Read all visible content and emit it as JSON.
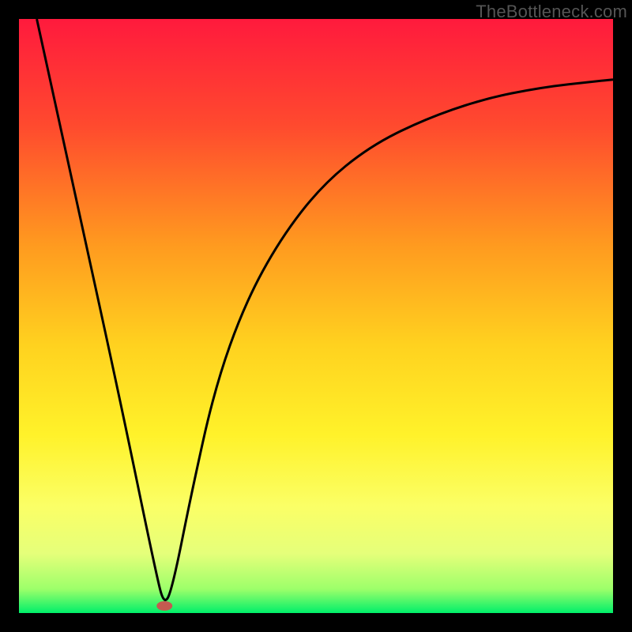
{
  "watermark": "TheBottleneck.com",
  "chart_data": {
    "type": "line",
    "title": "",
    "xlabel": "",
    "ylabel": "",
    "xlim": [
      0,
      100
    ],
    "ylim": [
      0,
      100
    ],
    "grid": false,
    "legend": false,
    "background_gradient": {
      "type": "vertical",
      "stops": [
        {
          "pos": 0.0,
          "color": "#ff1a3d"
        },
        {
          "pos": 0.18,
          "color": "#ff4a2e"
        },
        {
          "pos": 0.38,
          "color": "#ff9a1f"
        },
        {
          "pos": 0.55,
          "color": "#ffd21f"
        },
        {
          "pos": 0.7,
          "color": "#fff22a"
        },
        {
          "pos": 0.82,
          "color": "#fbff66"
        },
        {
          "pos": 0.9,
          "color": "#e5ff7a"
        },
        {
          "pos": 0.96,
          "color": "#9cff6a"
        },
        {
          "pos": 1.0,
          "color": "#00ef6a"
        }
      ]
    },
    "marker": {
      "x": 24.5,
      "y": 1.2,
      "color": "#c45a50"
    },
    "series": [
      {
        "name": "curve",
        "stroke": "#000000",
        "x": [
          3.0,
          10.0,
          17.0,
          23.0,
          24.5,
          26.0,
          29.0,
          33.0,
          38.0,
          44.0,
          51.0,
          59.0,
          68.0,
          78.0,
          88.0,
          97.0,
          100.0
        ],
        "y": [
          100.0,
          68.0,
          36.0,
          7.0,
          1.0,
          5.0,
          20.0,
          38.0,
          52.0,
          63.0,
          72.0,
          78.5,
          83.0,
          86.5,
          88.5,
          89.5,
          89.8
        ]
      }
    ]
  }
}
